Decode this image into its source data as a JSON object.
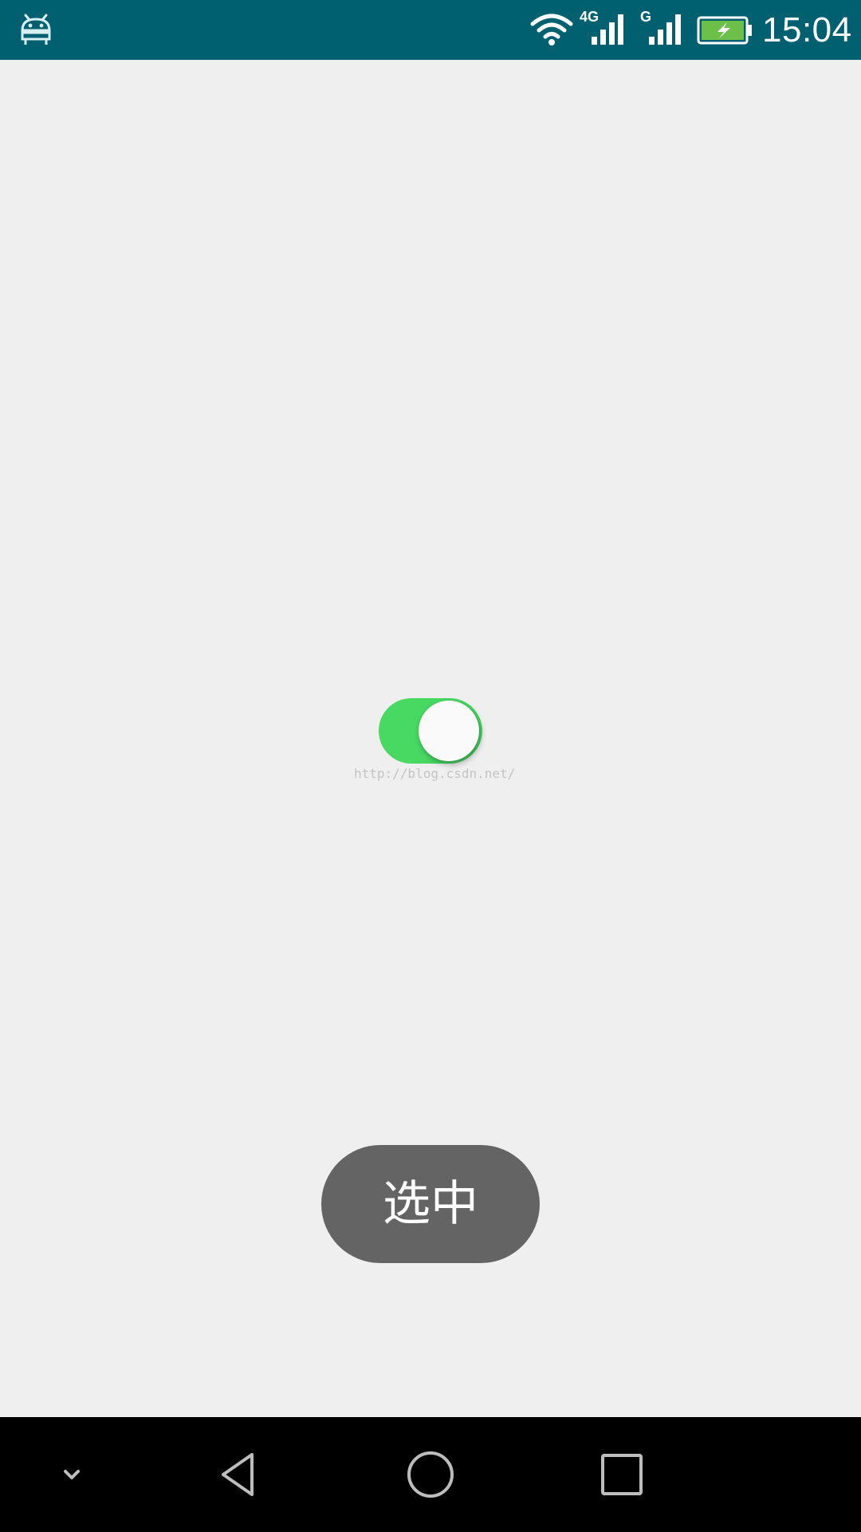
{
  "status_bar": {
    "time": "15:04",
    "network_4g_label": "4G",
    "network_g_label": "G",
    "icons": {
      "notification": "android-icon",
      "wifi": "wifi-icon",
      "signal_primary": "signal-4g-icon",
      "signal_secondary": "signal-g-icon",
      "battery": "battery-charging-icon"
    },
    "colors": {
      "background": "#006070",
      "battery_fill": "#6cc04a"
    }
  },
  "main": {
    "toggle": {
      "state": "on",
      "color_on": "#48d963"
    },
    "watermark": "http://blog.csdn.net/"
  },
  "toast": {
    "text": "选中"
  },
  "nav_bar": {
    "icons": {
      "hide": "chevron-down-icon",
      "back": "back-triangle-icon",
      "home": "home-circle-icon",
      "recent": "recent-square-icon"
    }
  }
}
